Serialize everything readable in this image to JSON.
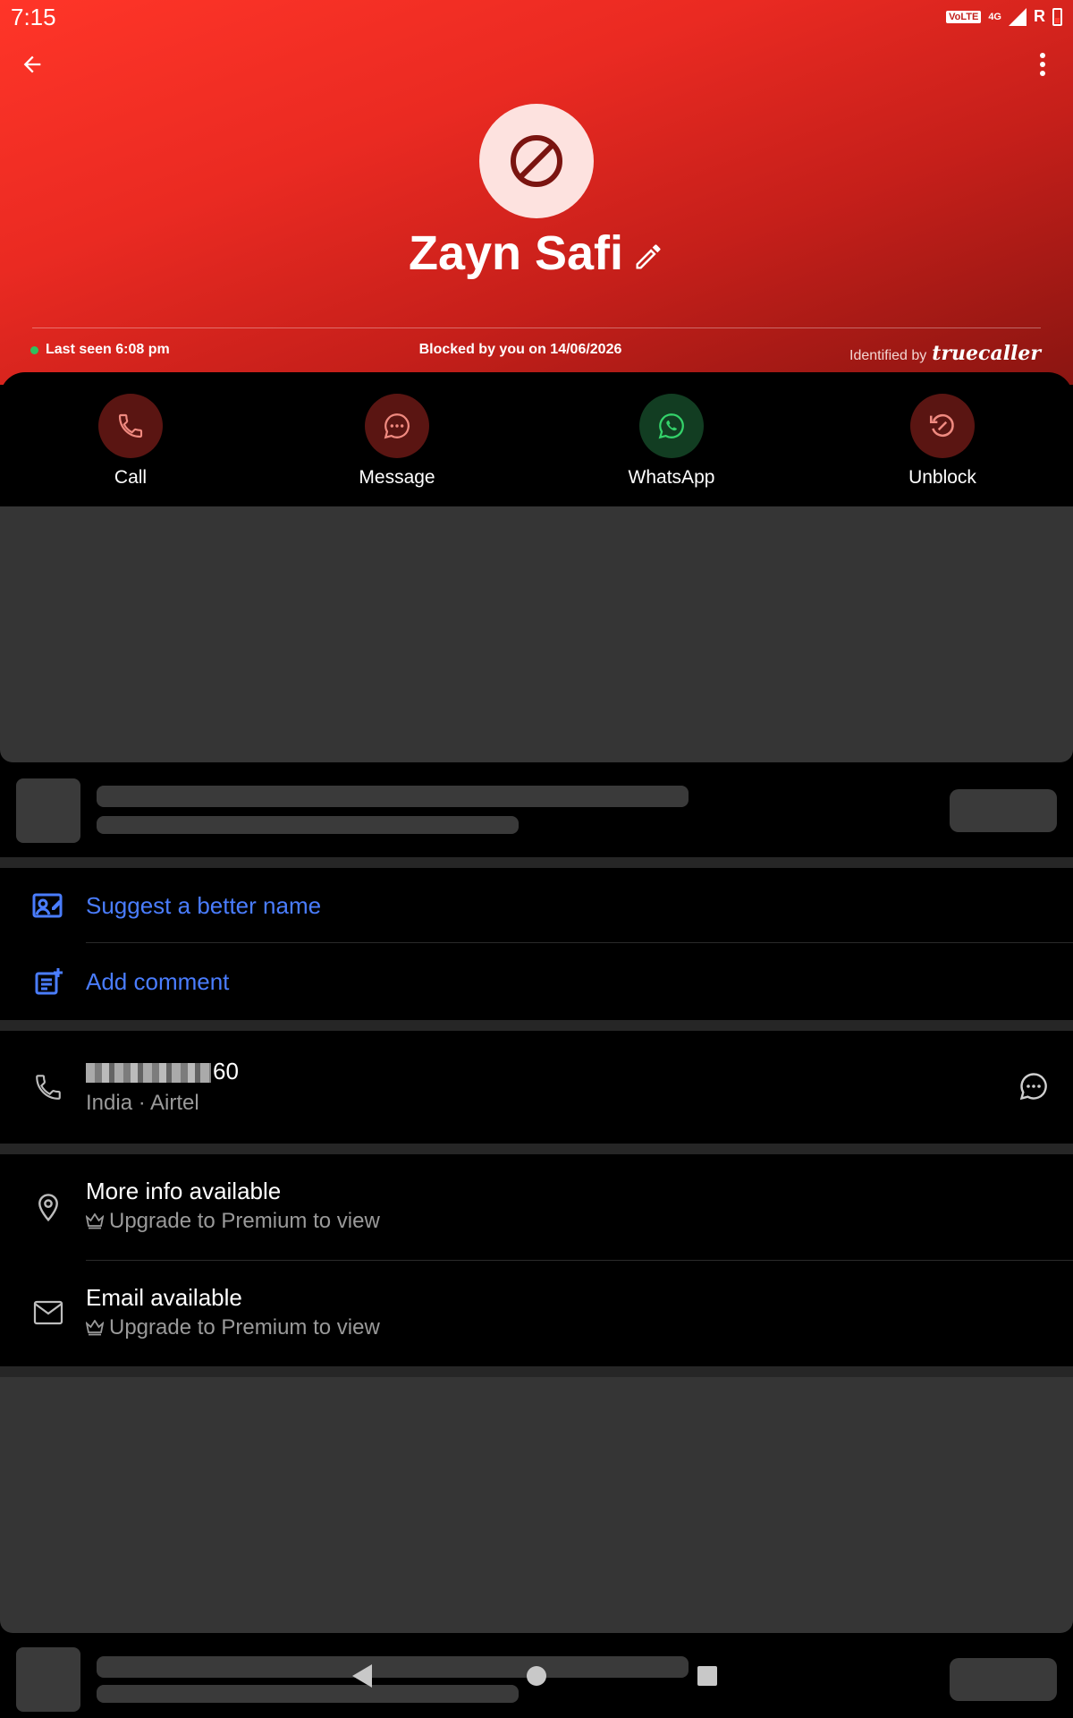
{
  "status_bar": {
    "time": "7:15",
    "volte": "VoLTE",
    "network": "4G",
    "roaming": "R"
  },
  "header": {
    "contact_name": "Zayn Safi",
    "last_seen": "Last seen 6:08 pm",
    "blocked_text": "Blocked by you on 14/06/2026",
    "identified_by": "Identified by",
    "brand": "truecaller"
  },
  "actions": [
    {
      "label": "Call",
      "icon": "phone-icon",
      "color": "#5a1512"
    },
    {
      "label": "Message",
      "icon": "message-icon",
      "color": "#5a1512"
    },
    {
      "label": "WhatsApp",
      "icon": "whatsapp-icon",
      "color": "#123d22"
    },
    {
      "label": "Unblock",
      "icon": "unblock-icon",
      "color": "#5a1512"
    }
  ],
  "suggestions": {
    "suggest_name": "Suggest a better name",
    "add_comment": "Add comment"
  },
  "phone": {
    "number_suffix": "60",
    "details": "India · Airtel"
  },
  "premium": [
    {
      "title": "More info available",
      "subtitle": "Upgrade to Premium to view",
      "icon": "location-icon"
    },
    {
      "title": "Email available",
      "subtitle": "Upgrade to Premium to view",
      "icon": "email-icon"
    }
  ],
  "colors": {
    "accent_blue": "#4a7dff",
    "header_red": "#e52a22",
    "online_green": "#2fc15e"
  }
}
